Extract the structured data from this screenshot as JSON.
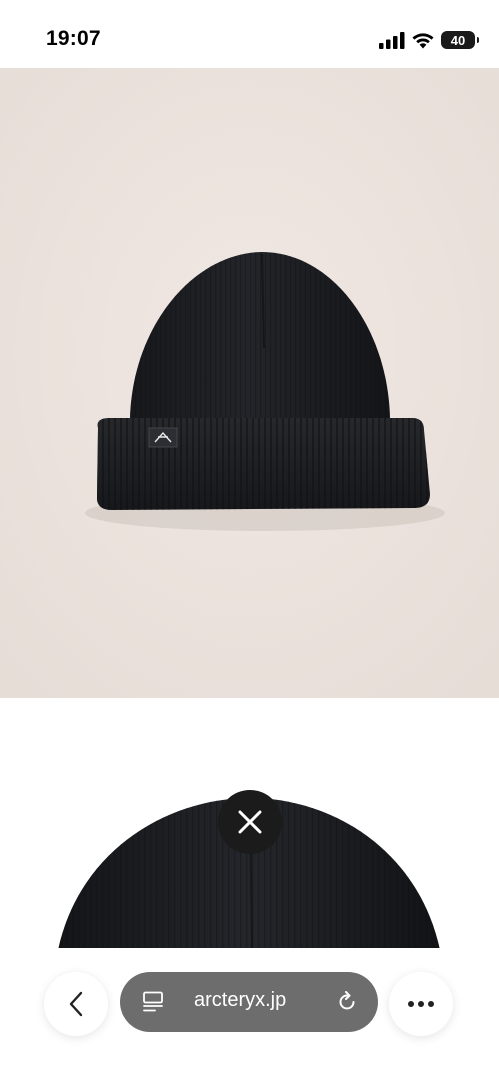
{
  "status_bar": {
    "time": "19:07",
    "battery_level": "40",
    "icons": [
      "cellular-signal-icon",
      "wifi-icon",
      "battery-icon"
    ]
  },
  "product": {
    "main_image": "black-beanie-with-logo-tag",
    "secondary_image": "black-beanie-crown-closeup",
    "background_color": "#ede4df",
    "item_color": "#1c1d20"
  },
  "overlay": {
    "close_icon": "close-icon"
  },
  "browser_bar": {
    "back_icon": "chevron-left-icon",
    "page_icon": "page-menu-icon",
    "url": "arcteryx.jp",
    "reload_icon": "reload-icon",
    "more_icon": "more-horizontal-icon"
  }
}
